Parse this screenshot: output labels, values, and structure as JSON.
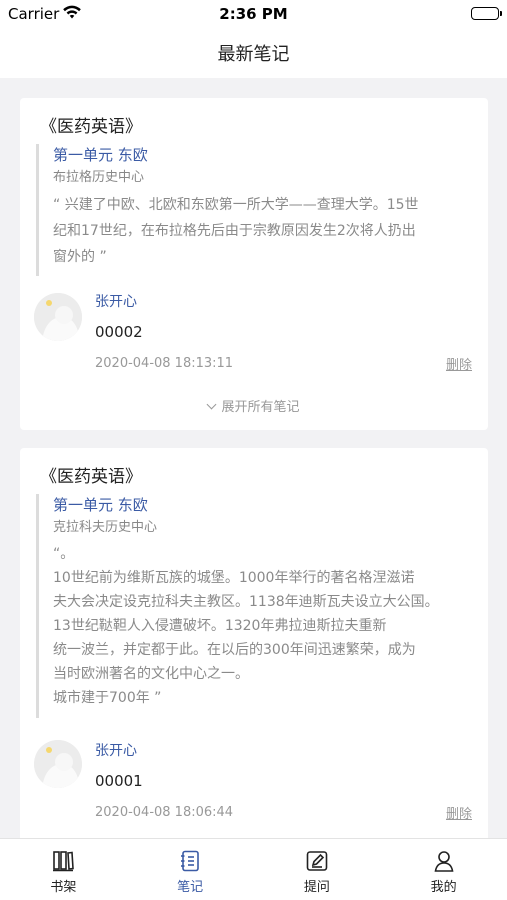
{
  "status": {
    "carrier": "Carrier",
    "time": "2:36 PM"
  },
  "nav": {
    "title": "最新笔记"
  },
  "cards": [
    {
      "book": "《医药英语》",
      "chapter": "第一单元 东欧",
      "place": "布拉格历史中心",
      "excerpt": "“ 兴建了中欧、北欧和东欧第一所大学——查理大学。15世\n纪和17世纪，在布拉格先后由于宗教原因发生2次将人扔出\n窗外的 ”",
      "user": "张开心",
      "note": "00002",
      "time": "2020-04-08 18:13:11",
      "delete": "删除",
      "expand": "展开所有笔记"
    },
    {
      "book": "《医药英语》",
      "chapter": "第一单元 东欧",
      "place": "克拉科夫历史中心",
      "excerpt": "“。\n10世纪前为维斯瓦族的城堡。1000年举行的著名格涅滋诺\n夫大会决定设克拉科夫主教区。1138年迪斯瓦夫设立大公国。\n13世纪鞑靼人入侵遭破坏。1320年弗拉迪斯拉夫重新\n统一波兰，并定都于此。在以后的300年间迅速繁荣，成为\n当时欧洲著名的文化中心之一。\n城市建于700年 ”",
      "user": "张开心",
      "note": "00001",
      "time": "2020-04-08 18:06:44",
      "delete": "删除"
    }
  ],
  "tabs": [
    {
      "label": "书架",
      "icon": "bookshelf-icon",
      "active": false
    },
    {
      "label": "笔记",
      "icon": "notes-icon",
      "active": true
    },
    {
      "label": "提问",
      "icon": "edit-question-icon",
      "active": false
    },
    {
      "label": "我的",
      "icon": "profile-icon",
      "active": false
    }
  ],
  "colors": {
    "accent": "#3b5ba5",
    "muted": "#999999",
    "background": "#f2f2f4"
  }
}
